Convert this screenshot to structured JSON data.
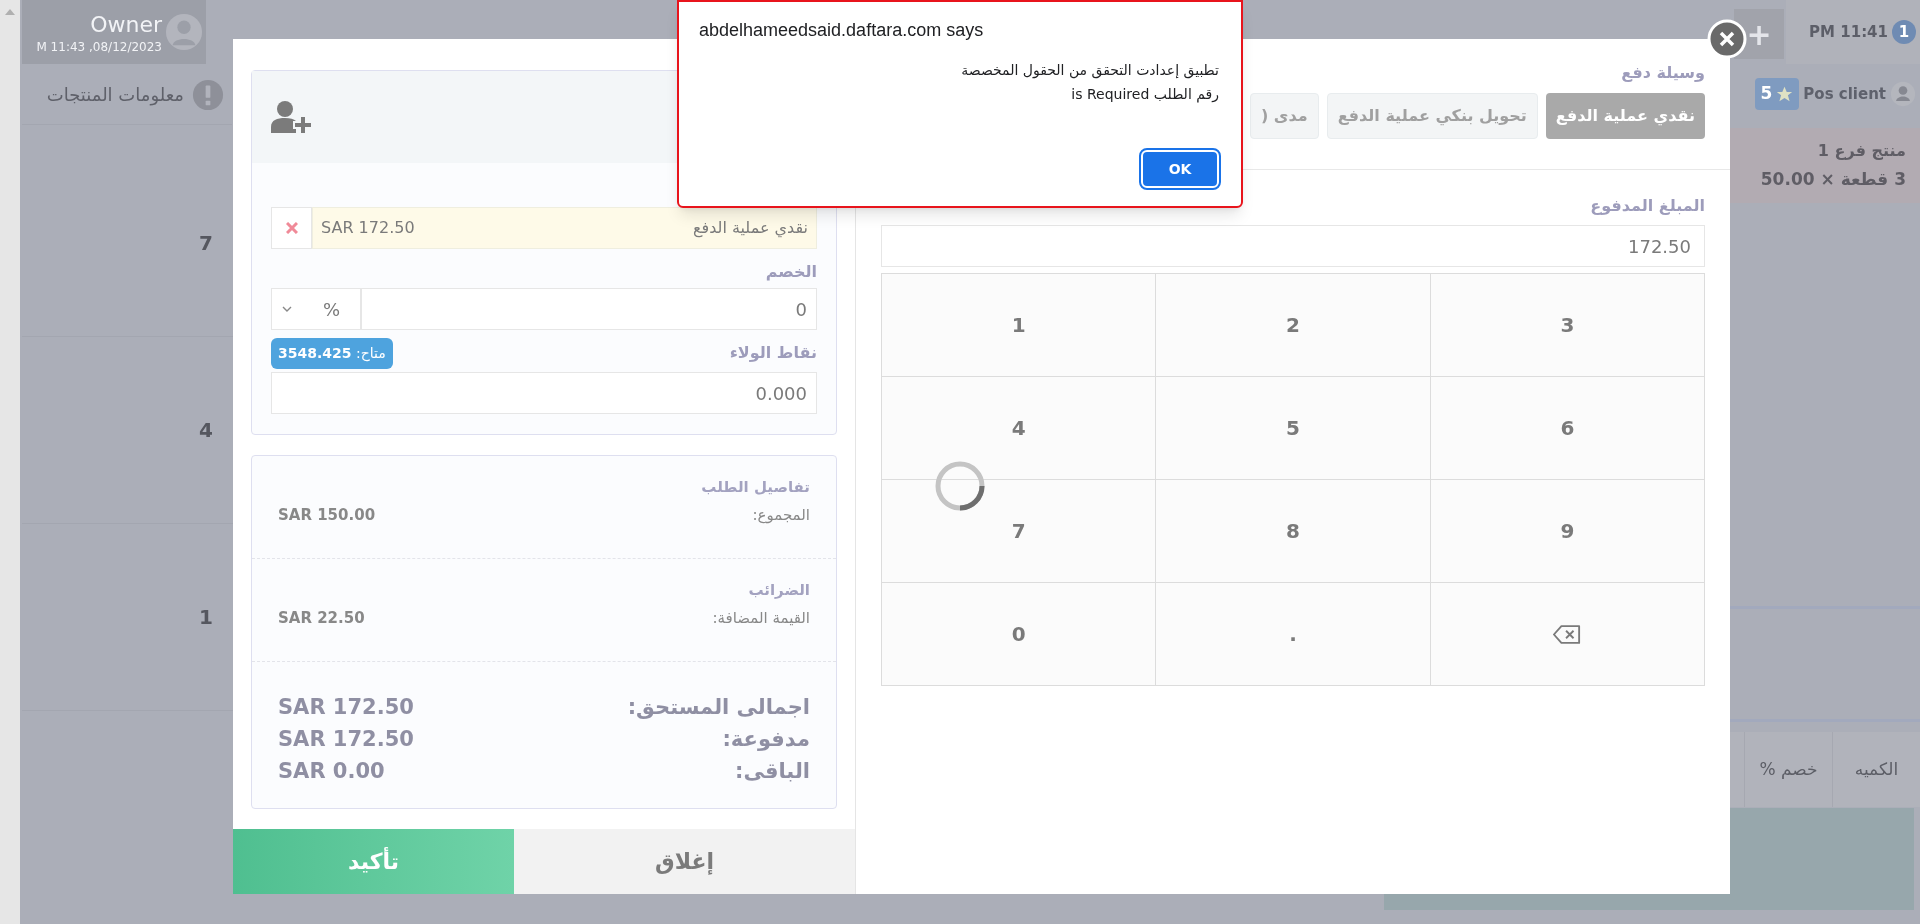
{
  "background": {
    "user": {
      "name": "Owner",
      "datetime": "M 11:43 ,08/12/2023"
    },
    "section_title": "معلومات المنتجات",
    "row_quantities": [
      "7",
      "4",
      "1"
    ],
    "add_button": "+",
    "clock": "PM 11:41",
    "session_badge": "1",
    "client": {
      "name": "Pos client",
      "points": "5"
    },
    "cart_item": {
      "name": "منتج فرع 1",
      "line": "3 قطعة × 50.00"
    },
    "table_columns": [
      "الكميه",
      "خصم %"
    ]
  },
  "payment_modal": {
    "payments": [
      {
        "method": "نقدي عملية الدفع",
        "amount": "SAR 172.50"
      }
    ],
    "discount": {
      "label": "الخصم",
      "value": "0",
      "type": "%"
    },
    "loyalty": {
      "label": "نقاط الولاء",
      "available": "متاح: **3548.425**",
      "value": "0.000"
    },
    "order_details": {
      "title": "تفاصيل الطلب",
      "rows": [
        {
          "label": "المجموع:",
          "value": "SAR 150.00"
        }
      ]
    },
    "taxes": {
      "title": "الضرائب",
      "rows": [
        {
          "label": "القيمة المضافة:",
          "value": "SAR 22.50"
        }
      ]
    },
    "totals": [
      {
        "label": "اجمالى المستحق:",
        "value": "SAR 172.50"
      },
      {
        "label": "مدفوعة:",
        "value": "SAR 172.50"
      },
      {
        "label": "الباقى:",
        "value": "SAR 0.00"
      }
    ],
    "buttons": [
      {
        "label": "إغلاق",
        "kind": "secondary"
      },
      {
        "label": "تأكيد",
        "kind": "primary"
      }
    ],
    "payment_methods": {
      "label": "وسيلة دفع",
      "items": [
        {
          "label": "نقدي عملية الدفع",
          "selected": true
        },
        {
          "label": "تحويل بنكي عملية الدفع",
          "selected": false
        },
        {
          "label": "مدى (",
          "selected": false
        }
      ]
    },
    "amount_paid": {
      "label": "المبلغ المدفوع",
      "value": "172.50"
    },
    "keypad": [
      {
        "kind": "digit",
        "label": "3"
      },
      {
        "kind": "digit",
        "label": "2"
      },
      {
        "kind": "digit",
        "label": "1"
      },
      {
        "kind": "digit",
        "label": "6"
      },
      {
        "kind": "digit",
        "label": "5"
      },
      {
        "kind": "digit",
        "label": "4"
      },
      {
        "kind": "digit",
        "label": "9"
      },
      {
        "kind": "digit",
        "label": "8"
      },
      {
        "kind": "digit",
        "label": "7"
      },
      {
        "kind": "backspace"
      },
      {
        "kind": "digit",
        "label": "."
      },
      {
        "kind": "digit",
        "label": "0"
      }
    ],
    "loading": true
  },
  "alert": {
    "title": "abdelhameedsaid.daftara.com says",
    "message_lines": [
      "تطبيق إعدادت التحقق من الحقول المخصصة",
      "رقم الطلب is Required"
    ],
    "button": "OK"
  }
}
